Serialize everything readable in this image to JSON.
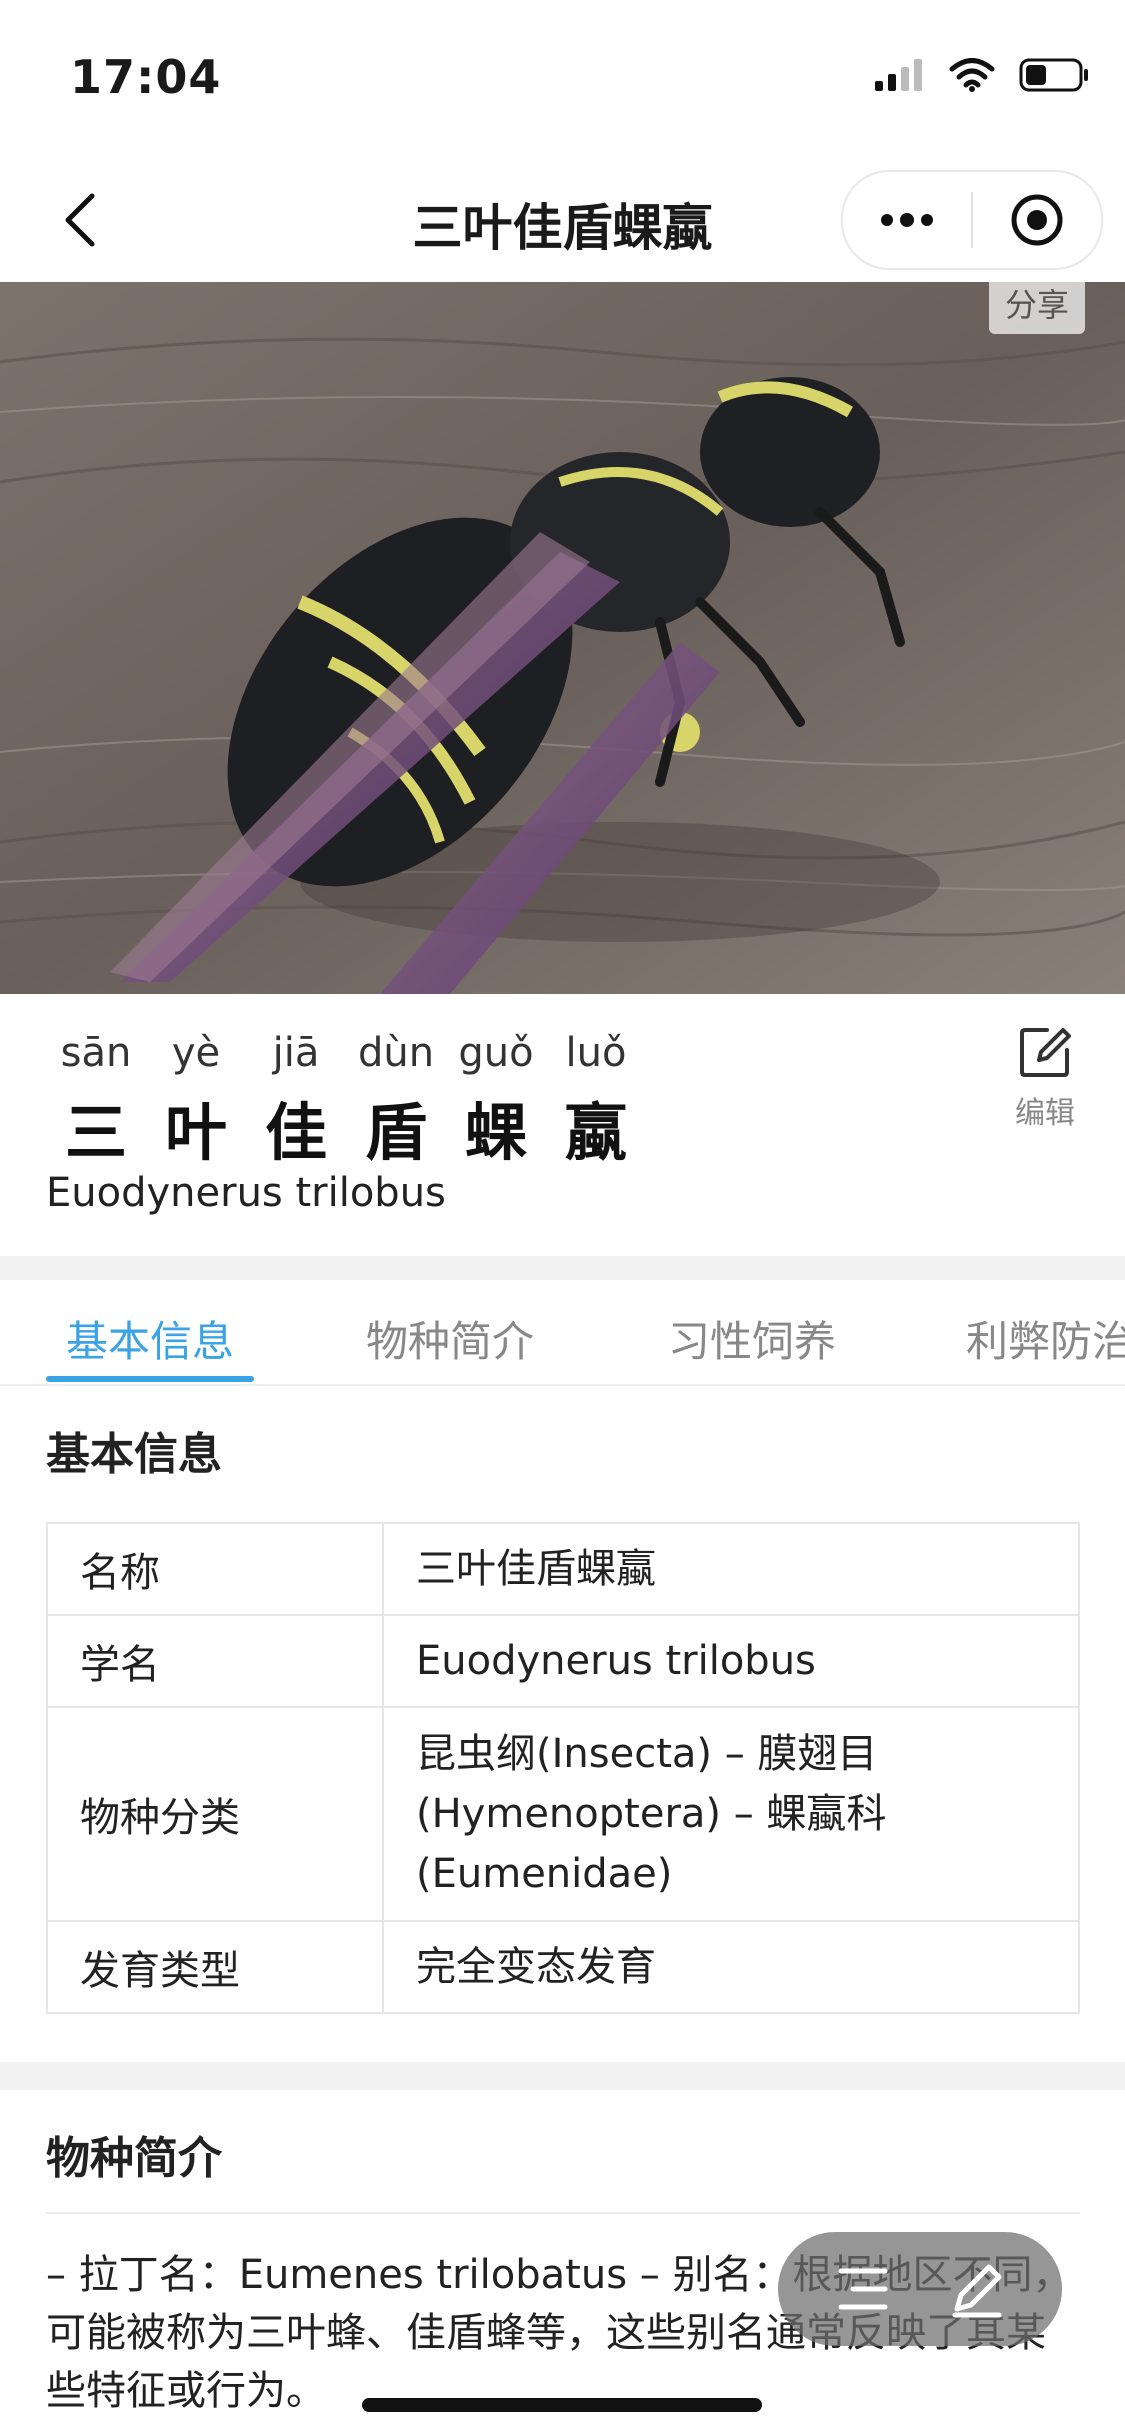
{
  "status_bar": {
    "time": "17:04"
  },
  "nav": {
    "title": "三叶佳盾蜾蠃"
  },
  "hero": {
    "share_label": "分享"
  },
  "header": {
    "pinyin": [
      "sān",
      "yè",
      "jiā",
      "dùn",
      "guǒ",
      "luǒ"
    ],
    "hanzi": [
      "三",
      "叶",
      "佳",
      "盾",
      "蜾",
      "蠃"
    ],
    "latin_name": "Euodynerus trilobus",
    "edit_label": "编辑"
  },
  "tabs": [
    {
      "label": "基本信息",
      "active": true
    },
    {
      "label": "物种简介",
      "active": false
    },
    {
      "label": "习性饲养",
      "active": false
    },
    {
      "label": "利弊防治",
      "active": false
    }
  ],
  "basic_info": {
    "title": "基本信息",
    "rows": [
      {
        "key": "名称",
        "value": [
          "三叶佳盾蜾蠃"
        ]
      },
      {
        "key": "学名",
        "value": [
          "Euodynerus trilobus"
        ]
      },
      {
        "key": "物种分类",
        "value": [
          "昆虫纲(Insecta) – 膜翅目",
          "(Hymenoptera) – 蜾蠃科",
          "(Eumenidae)"
        ]
      },
      {
        "key": "发育类型",
        "value": [
          "完全变态发育"
        ]
      }
    ]
  },
  "intro": {
    "title": "物种简介",
    "text": "– 拉丁名：Eumenes trilobatus – 别名：根据地区不同，可能被称为三叶蜂、佳盾蜂等，这些别名通常反映了其某些特征或行为。"
  },
  "colors": {
    "accent": "#3aa3e6",
    "divider": "#f2f2f2"
  },
  "icons": [
    "back-arrow-icon",
    "more-dots-icon",
    "target-circle-icon",
    "edit-icon",
    "list-icon",
    "pen-icon"
  ]
}
